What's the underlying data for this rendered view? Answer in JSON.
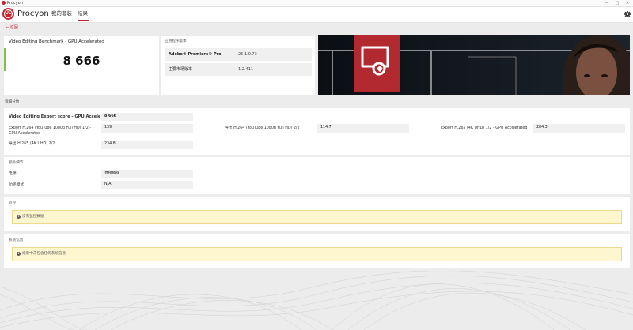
{
  "window": {
    "title": "Procyon",
    "controls": [
      "—",
      "□",
      "✕"
    ]
  },
  "header": {
    "brand": "Procyon",
    "nav": [
      {
        "label": "我的套装"
      },
      {
        "label": "结果"
      }
    ],
    "logo_letters": "UL"
  },
  "back": {
    "label": "返回"
  },
  "score_card": {
    "title": "Video Editing Benchmark - GPU Accelerated",
    "score": "8 666"
  },
  "app_card": {
    "title": "应用程序版本",
    "rows": [
      {
        "key": "Adobe® Premiere® Pro",
        "value": "25.1.0.73"
      },
      {
        "key": "主要市场版本",
        "value": "1.2.411"
      }
    ]
  },
  "details": {
    "title": "详细分数",
    "main": {
      "label": "Video Editing Export score - GPU Accelerated",
      "value": "8 666"
    },
    "items": [
      {
        "label": "Export H.264 (YouTube 1080p Full HD) 1/2 - GPU Accelerated",
        "value": "139"
      },
      {
        "label": "导出 H.264 (YouTube 1080p Full HD) 2/2",
        "value": "114.7"
      },
      {
        "label": "Export H.265 (4K UHD) 1/2 - GPU Accelerated",
        "value": "284.3"
      },
      {
        "label": "导出 H.265 (4K UHD) 2/2",
        "value": "234.8"
      }
    ]
  },
  "extra": {
    "title": "额外细节",
    "rows": [
      {
        "key": "电源",
        "value": "直接插座"
      },
      {
        "key": "功耗模式",
        "value": "N/A"
      }
    ]
  },
  "monitor": {
    "title": "监控",
    "note": "没有监控数据"
  },
  "sysinfo": {
    "title": "系统信息",
    "note": "结果中未包含任何系统信息"
  },
  "colors": {
    "accent": "#c0272d",
    "score_bar": "#7fc04a",
    "note_bg": "#fdf6cf"
  }
}
